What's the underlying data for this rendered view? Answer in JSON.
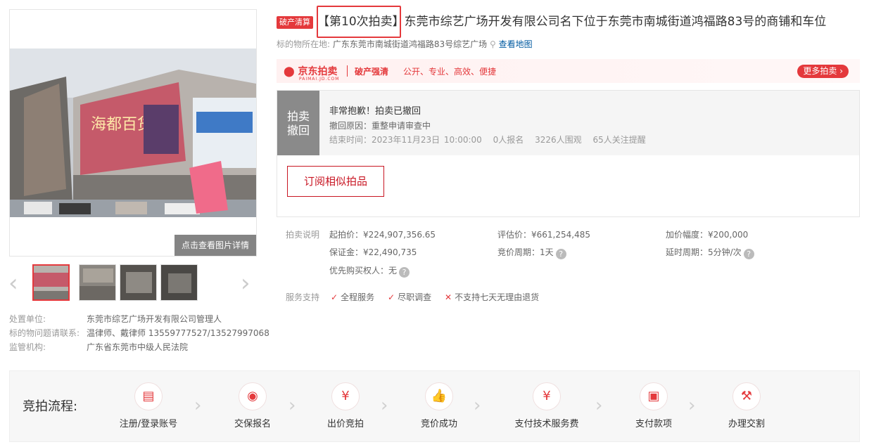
{
  "gallery": {
    "photo_button": "点击查看图片详情"
  },
  "disposal": {
    "rows": [
      {
        "label": "处置单位:",
        "value": "东莞市综艺广场开发有限公司管理人"
      },
      {
        "label": "标的物问题请联系:",
        "value": "温律师、戴律师 13559777527/13527997068"
      },
      {
        "label": "监管机构:",
        "value": "广东省东莞市中级人民法院"
      }
    ]
  },
  "header": {
    "badge": "破产清算",
    "title": "【第10次拍卖】东莞市综艺广场开发有限公司名下位于东莞市南城街道鸿福路83号的商铺和车位",
    "location_label": "标的物所在地:",
    "location_value": "广东东莞市南城街道鸿福路83号综艺广场",
    "map_link": "查看地图"
  },
  "banner": {
    "logo": "京东拍卖",
    "logo_sub": "PAIMAI.JD.COM",
    "slogan1": "破产强清",
    "slogan2": "公开、专业、高效、便捷",
    "more": "更多拍卖"
  },
  "status": {
    "tag_line1": "拍卖",
    "tag_line2": "撤回",
    "title": "非常抱歉！拍卖已撤回",
    "reason": "撤回原因：重整申请审查中",
    "end_label": "结束时间：",
    "end_time": "2023年11月23日 10:00:00",
    "signups": "0人报名",
    "watchers": "3226人围观",
    "reminders": "65人关注提醒",
    "subscribe_button": "订阅相似拍品"
  },
  "auction": {
    "label": "拍卖说明",
    "start_price": "起拍价：¥224,907,356.65",
    "appraisal": "评估价：¥661,254,485",
    "increment": "加价幅度：¥200,000",
    "deposit": "保证金：¥22,490,735",
    "cycle": "竞价周期：1天",
    "delay": "延时周期：5分钟/次",
    "priority": "优先购买权人：无"
  },
  "service": {
    "label": "服务支持",
    "items": [
      "全程服务",
      "尽职调查",
      "不支持七天无理由退货"
    ]
  },
  "process": {
    "title": "竞拍流程:",
    "steps": [
      {
        "label": "注册/登录账号",
        "icon": "id-card-icon"
      },
      {
        "label": "交保报名",
        "icon": "eye-icon"
      },
      {
        "label": "出价竞拍",
        "icon": "yen-coin-icon"
      },
      {
        "label": "竞价成功",
        "icon": "thumbs-up-icon"
      },
      {
        "label": "支付技术服务费",
        "icon": "yen-bag-icon"
      },
      {
        "label": "支付款项",
        "icon": "wallet-icon"
      },
      {
        "label": "办理交割",
        "icon": "gavel-icon"
      }
    ]
  },
  "colors": {
    "accent": "#e4393c",
    "link": "#005aa0"
  }
}
